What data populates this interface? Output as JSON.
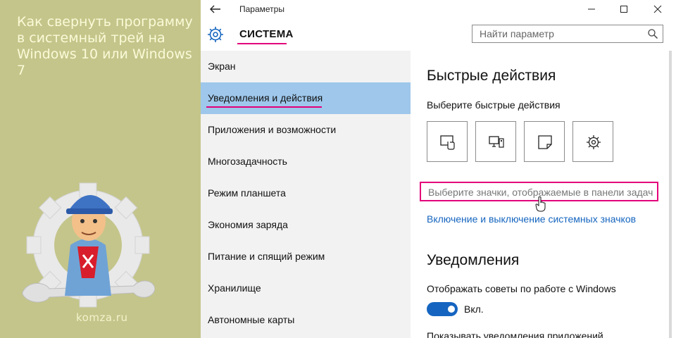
{
  "article": {
    "title": "Как свернуть программу в системный трей на Windows 10 или Windows 7",
    "watermark": "komza.ru"
  },
  "window": {
    "title": "Параметры",
    "back_icon": "back-arrow-icon",
    "controls": [
      "minimize-icon",
      "maximize-icon",
      "close-icon"
    ]
  },
  "header": {
    "section_title": "СИСТЕМА",
    "section_icon": "gear-icon",
    "search_placeholder": "Найти параметр",
    "search_icon": "search-icon"
  },
  "nav": {
    "items": [
      {
        "label": "Экран",
        "active": false
      },
      {
        "label": "Уведомления и действия",
        "active": true
      },
      {
        "label": "Приложения и возможности",
        "active": false
      },
      {
        "label": "Многозадачность",
        "active": false
      },
      {
        "label": "Режим планшета",
        "active": false
      },
      {
        "label": "Экономия заряда",
        "active": false
      },
      {
        "label": "Питание и спящий режим",
        "active": false
      },
      {
        "label": "Хранилище",
        "active": false
      },
      {
        "label": "Автономные карты",
        "active": false
      }
    ]
  },
  "content": {
    "quick_actions_heading": "Быстрые действия",
    "quick_actions_subtitle": "Выберите быстрые действия",
    "quick_action_icons": [
      "tablet-mode-icon",
      "project-icon",
      "note-icon",
      "settings-gear-icon"
    ],
    "taskbar_icons_link": "Выберите значки, отображаемые в панели задач",
    "system_icons_link": "Включение и выключение системных значков",
    "notifications_heading": "Уведомления",
    "tips_label": "Отображать советы по работе с Windows",
    "tips_toggle_state": "Вкл.",
    "app_notifications_label": "Показывать уведомления приложений"
  },
  "colors": {
    "accent": "#1565c0",
    "highlight": "#e3007a",
    "nav_active_bg": "#9ec7eb",
    "left_panel_bg": "#c4c58a"
  }
}
